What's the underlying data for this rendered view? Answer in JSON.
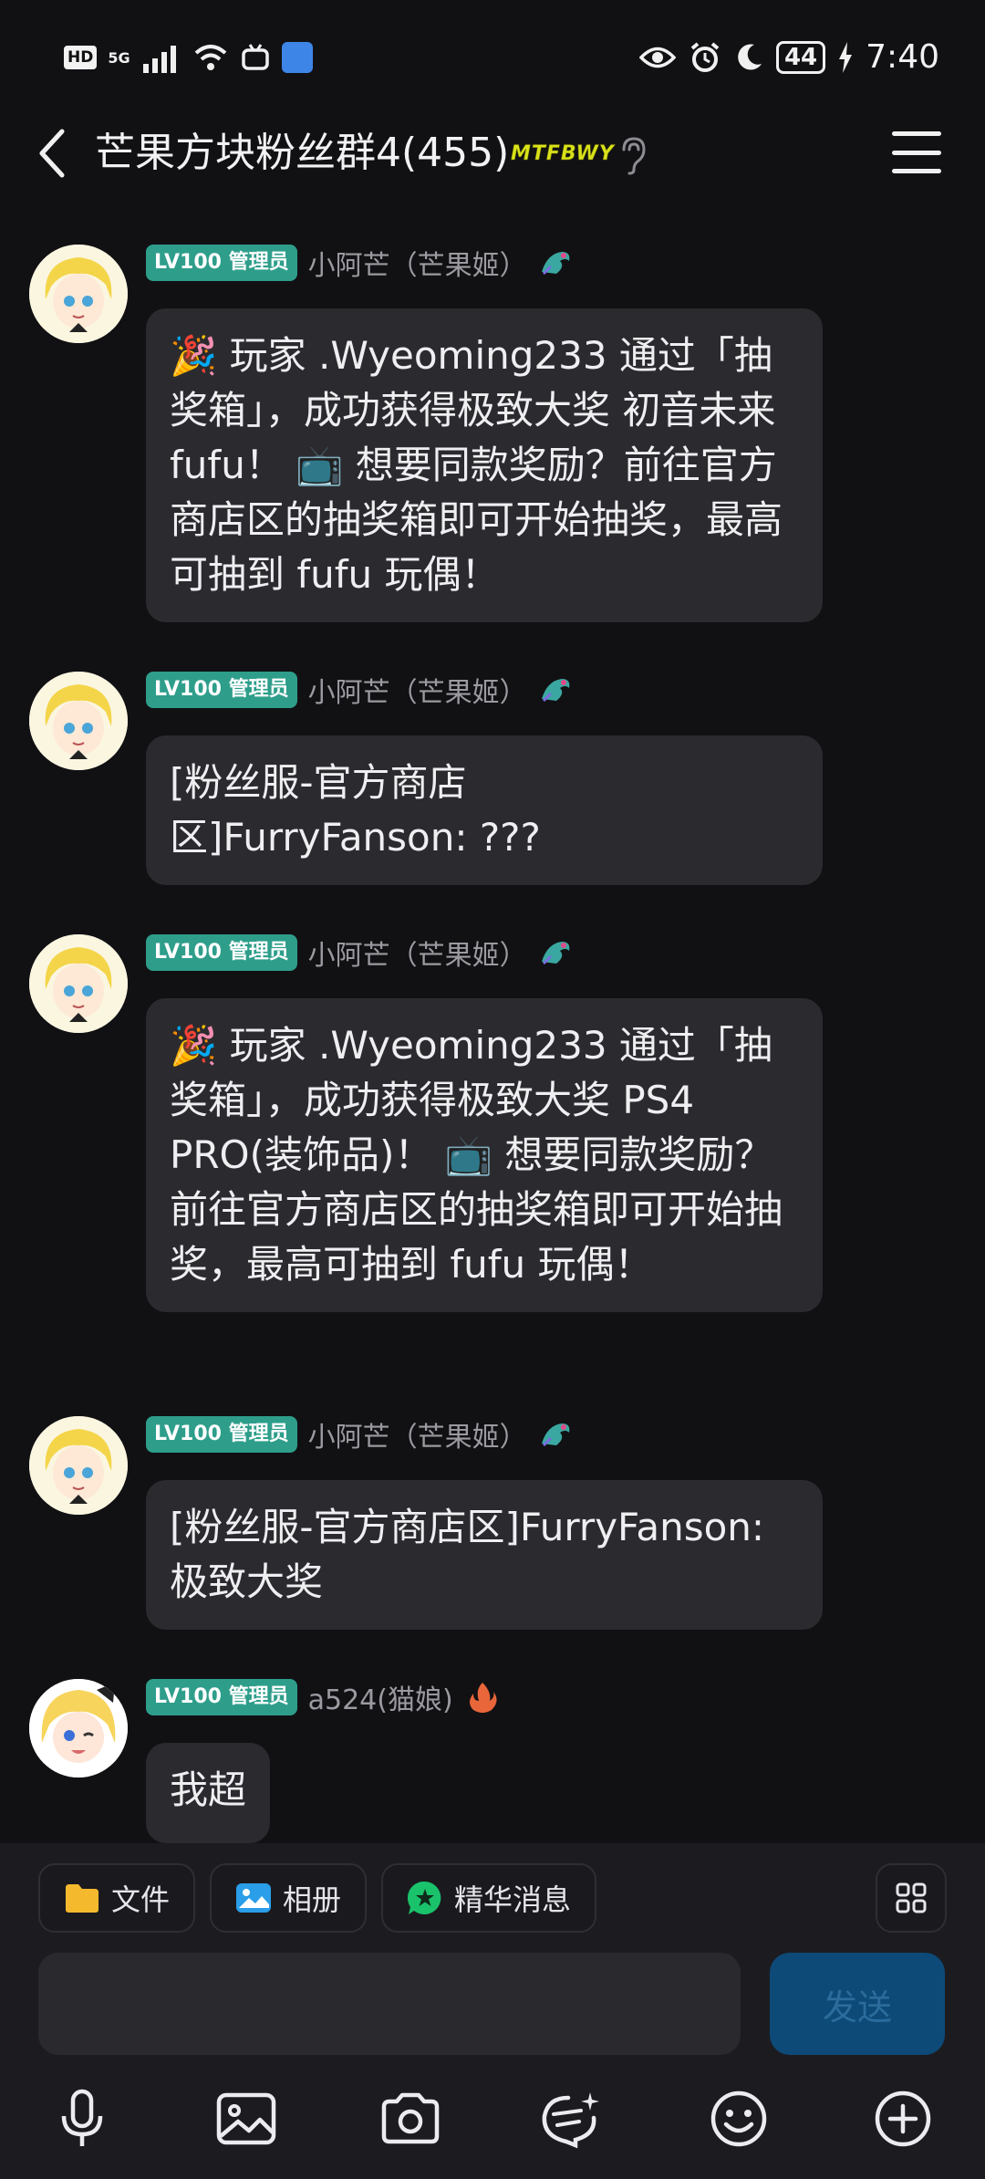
{
  "status_bar": {
    "hd": "HD",
    "network": "5G",
    "battery": "44",
    "time": "7:40"
  },
  "header": {
    "title": "芒果方块粉丝群4(455)",
    "badge": "MTFBWY"
  },
  "messages": [
    {
      "role": "LV100 管理员",
      "sender": "小阿芒（芒果姬）",
      "text": "🎉 玩家 .Wyeoming233 通过「抽奖箱」，成功获得极致大奖 初音未来fufu！ 📺 想要同款奖励？前往官方商店区的抽奖箱即可开始抽奖，最高可抽到 fufu 玩偶！"
    },
    {
      "role": "LV100 管理员",
      "sender": "小阿芒（芒果姬）",
      "text": "[粉丝服-官方商店区]FurryFanson: ???"
    },
    {
      "role": "LV100 管理员",
      "sender": "小阿芒（芒果姬）",
      "text": "🎉 玩家 .Wyeoming233 通过「抽奖箱」，成功获得极致大奖 PS4 PRO(装饰品)！ 📺 想要同款奖励？前往官方商店区的抽奖箱即可开始抽奖，最高可抽到 fufu 玩偶！"
    },
    {
      "role": "LV100 管理员",
      "sender": "小阿芒（芒果姬）",
      "text": "[粉丝服-官方商店区]FurryFanson: 极致大奖"
    },
    {
      "role": "LV100 管理员",
      "sender": "a524(猫娘)",
      "text": "我超"
    }
  ],
  "composer": {
    "chips": [
      "文件",
      "相册",
      "精华消息"
    ],
    "send": "发送"
  },
  "icons": {
    "back": "chevron-left-icon",
    "menu": "hamburger-menu-icon",
    "ear": "ear-icon",
    "toolbar": [
      "microphone-icon",
      "image-icon",
      "camera-icon",
      "sticker-icon",
      "emoji-icon",
      "plus-icon"
    ]
  },
  "colors": {
    "background": "#111114",
    "bubble": "#2b2b2f",
    "role_badge": "#2e9e8b",
    "send_button": "#0d4a78"
  }
}
